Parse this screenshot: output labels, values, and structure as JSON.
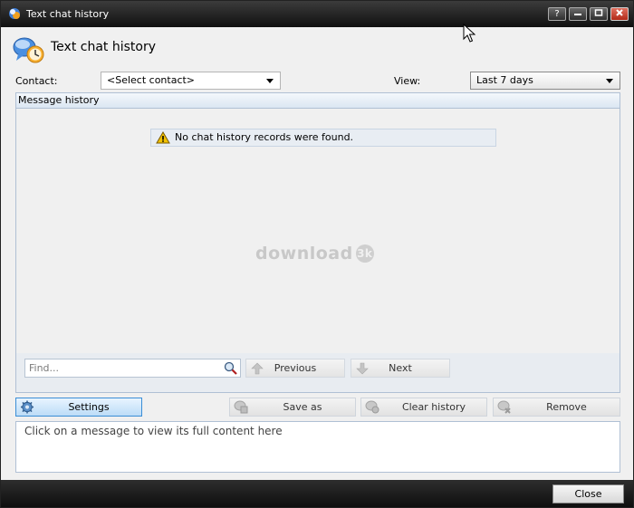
{
  "window": {
    "title": "Text chat history"
  },
  "header": {
    "title": "Text chat history",
    "icon": "chat-history-clock-icon"
  },
  "filters": {
    "contact_label": "Contact:",
    "contact_value": "<Select contact>",
    "view_label": "View:",
    "view_value": "Last 7 days"
  },
  "history": {
    "title": "Message history",
    "notice": "No chat history records were found.",
    "watermark": "download",
    "watermark_badge": "3k"
  },
  "find": {
    "placeholder": "Find...",
    "previous_label": "Previous",
    "next_label": "Next"
  },
  "actions": {
    "settings_label": "Settings",
    "save_as_label": "Save as",
    "clear_history_label": "Clear history",
    "remove_label": "Remove"
  },
  "detail": {
    "placeholder": "Click on a message to view its full content here"
  },
  "footer": {
    "close_label": "Close"
  },
  "colors": {
    "accent_blue": "#3b8ed6",
    "panel_border": "#b0c0d4",
    "titlebar": "#1a1a1a",
    "warning_yellow": "#f2c200"
  }
}
